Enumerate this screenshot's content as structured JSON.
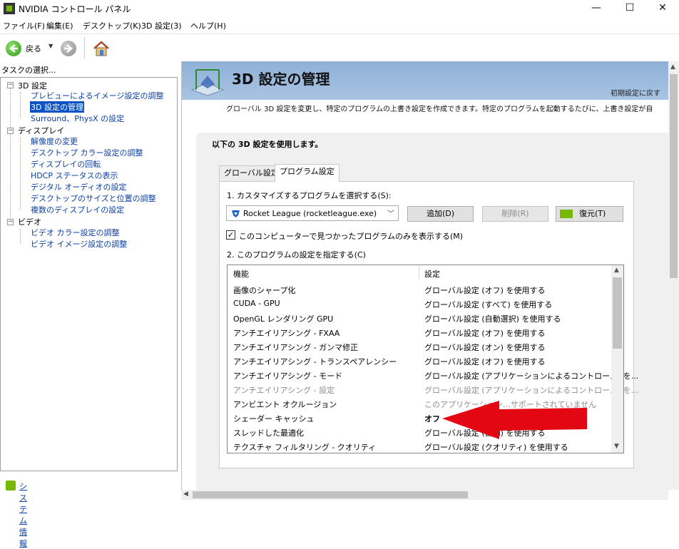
{
  "window": {
    "title": "NVIDIA コントロール パネル",
    "controls": [
      "—",
      "☐",
      "✕"
    ]
  },
  "menu": [
    "ファイル(F)",
    "編集(E)",
    "デスクトップ(K)",
    "3D 設定(3)",
    "ヘルプ(H)"
  ],
  "toolbar": {
    "back_label": "戻る"
  },
  "sidebar": {
    "task_label": "タスクの選択...",
    "groups": [
      {
        "label": "3D 設定",
        "items": [
          "プレビューによるイメージ設定の調整",
          "3D 設定の管理",
          "Surround、PhysX の設定"
        ]
      },
      {
        "label": "ディスプレイ",
        "items": [
          "解像度の変更",
          "デスクトップ カラー設定の調整",
          "ディスプレイの回転",
          "HDCP ステータスの表示",
          "デジタル オーディオの設定",
          "デスクトップのサイズと位置の調整",
          "複数のディスプレイの設定"
        ]
      },
      {
        "label": "ビデオ",
        "items": [
          "ビデオ カラー設定の調整",
          "ビデオ イメージ設定の調整"
        ]
      }
    ],
    "system_info": "システム情報"
  },
  "main": {
    "title": "3D 設定の管理",
    "restore_defaults": "初期設定に戻す",
    "description": "グローバル 3D 設定を変更し、特定のプログラムの上書き設定を作成できます。特定のプログラムを起動するたびに、上書き設定が自",
    "card_title": "以下の 3D 設定を使用します。",
    "tabs": [
      "グローバル設定",
      "プログラム設定"
    ],
    "step1_label": "1. カスタマイズするプログラムを選択する(S):",
    "program_selected": "Rocket League (rocketleague.exe)",
    "add_button": "追加(D)",
    "remove_button": "削除(R)",
    "restore_button": "復元(T)",
    "checkbox_checked": true,
    "checkbox_label": "このコンピューターで見つかったプログラムのみを表示する(M)",
    "step2_label": "2. このプログラムの設定を指定する(C)",
    "columns": [
      "機能",
      "設定"
    ],
    "rows": [
      {
        "feature": "画像のシャープ化",
        "setting": "グローバル設定 (オフ) を使用する"
      },
      {
        "feature": "CUDA - GPU",
        "setting": "グローバル設定 (すべて) を使用する"
      },
      {
        "feature": "OpenGL レンダリング GPU",
        "setting": "グローバル設定 (自動選択) を使用する"
      },
      {
        "feature": "アンチエイリアシング - FXAA",
        "setting": "グローバル設定 (オフ) を使用する"
      },
      {
        "feature": "アンチエイリアシング - ガンマ修正",
        "setting": "グローバル設定 (オン) を使用する"
      },
      {
        "feature": "アンチエイリアシング - トランスペアレンシー",
        "setting": "グローバル設定 (オフ) を使用する"
      },
      {
        "feature": "アンチエイリアシング - モード",
        "setting": "グローバル設定 (アプリケーションによるコントロール) を..."
      },
      {
        "feature": "アンチエイリアシング - 設定",
        "setting": "グローバル設定 (アプリケーションによるコントロール) を..."
      },
      {
        "feature": "アンビエント オクルージョン",
        "setting": "このアプリケーション…サポートされていません"
      },
      {
        "feature": "シェーダー キャッシュ",
        "setting": "オフ"
      },
      {
        "feature": "スレッドした最適化",
        "setting": "グローバル設定 (自動) を使用する"
      },
      {
        "feature": "テクスチャ フィルタリング - クオリティ",
        "setting": "グローバル設定 (クオリティ) を使用する"
      }
    ]
  },
  "colors": {
    "accent": "#76b900",
    "selection": "#0b52c5",
    "link": "#0a3fa6",
    "arrow": "#e30613"
  }
}
